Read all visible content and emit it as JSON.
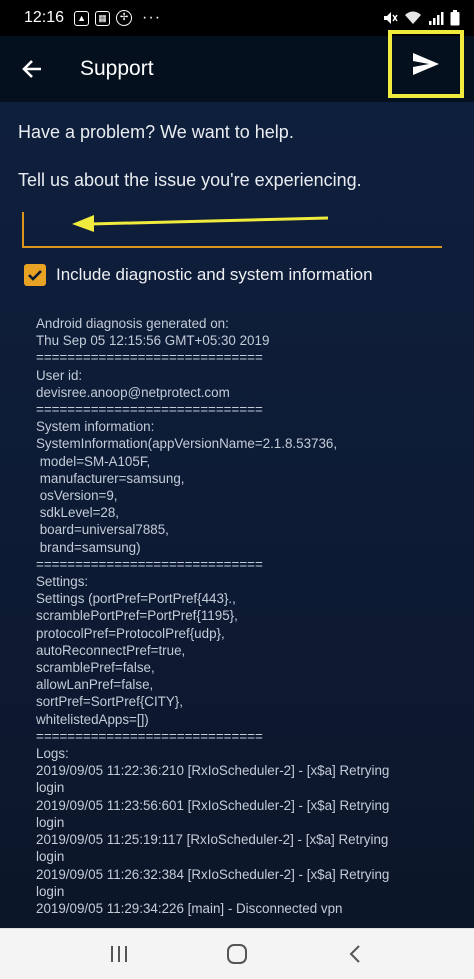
{
  "status_bar": {
    "time": "12:16",
    "more": "···",
    "icons": [
      "image-icon",
      "grid-icon",
      "compass-icon",
      "mute-icon",
      "wifi-icon",
      "signal-icon",
      "battery-icon"
    ]
  },
  "app_bar": {
    "title": "Support",
    "back_icon": "arrow-left-icon",
    "send_icon": "send-icon",
    "highlight_color": "#f0eb3c"
  },
  "content": {
    "intro_line1": "Have a problem? We want to help.",
    "intro_line2": "Tell us about the issue you're experiencing.",
    "issue_input": {
      "value": "",
      "placeholder": ""
    },
    "diagnostic_checkbox": {
      "checked": true,
      "label": "Include diagnostic and system information"
    },
    "accent_color": "#e8a325",
    "log_lines": [
      "Android diagnosis generated on:",
      "Thu Sep 05 12:15:56 GMT+05:30 2019",
      "=============================",
      "User id:",
      "devisree.anoop@netprotect.com",
      "=============================",
      "System information:",
      "SystemInformation(appVersionName=2.1.8.53736,",
      " model=SM-A105F,",
      " manufacturer=samsung,",
      " osVersion=9,",
      " sdkLevel=28,",
      " board=universal7885,",
      " brand=samsung)",
      "=============================",
      "Settings:",
      "Settings (portPref=PortPref{443}.,",
      "scramblePortPref=PortPref{1195},",
      "protocolPref=ProtocolPref{udp},",
      "autoReconnectPref=true,",
      "scramblePref=false,",
      "allowLanPref=false,",
      "sortPref=SortPref{CITY},",
      "whitelistedApps=[])",
      "=============================",
      "Logs:",
      "2019/09/05 11:22:36:210 [RxIoScheduler-2] - [x$a] Retrying",
      "login",
      "2019/09/05 11:23:56:601 [RxIoScheduler-2] - [x$a] Retrying",
      "login",
      "2019/09/05 11:25:19:117 [RxIoScheduler-2] - [x$a] Retrying",
      "login",
      "2019/09/05 11:26:32:384 [RxIoScheduler-2] - [x$a] Retrying",
      "login",
      "2019/09/05 11:29:34:226 [main] - Disconnected vpn"
    ]
  },
  "nav_bar": {
    "icons": [
      "recent-apps-icon",
      "home-icon",
      "back-nav-icon"
    ]
  }
}
